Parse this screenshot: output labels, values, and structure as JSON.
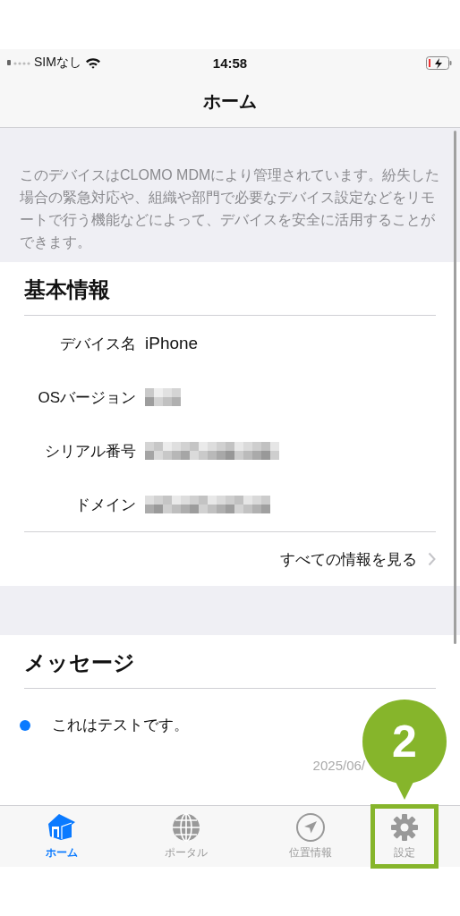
{
  "status_bar": {
    "carrier": "SIMなし",
    "time": "14:58",
    "battery_charging": true
  },
  "nav_bar": {
    "title": "ホーム"
  },
  "description": "このデバイスはCLOMO MDMにより管理されています。紛失した場合の緊急対応や、組織や部門で必要なデバイス設定などをリモートで行う機能などによって、デバイスを安全に活用することができます。",
  "basic_info": {
    "title": "基本情報",
    "rows": [
      {
        "label": "デバイス名",
        "kind": "text",
        "value": "iPhone"
      },
      {
        "label": "OSバージョン",
        "kind": "redacted"
      },
      {
        "label": "シリアル番号",
        "kind": "redacted"
      },
      {
        "label": "ドメイン",
        "kind": "redacted"
      }
    ],
    "more_link": "すべての情報を見る"
  },
  "messages": {
    "title": "メッセージ",
    "items": [
      {
        "text": "これはテストです。",
        "unread": true,
        "date": "2025/06/"
      }
    ]
  },
  "tab_bar": [
    {
      "label": "ホーム",
      "kind": "home",
      "selected": true,
      "highlighted": false
    },
    {
      "label": "ポータル",
      "kind": "portal",
      "selected": false,
      "highlighted": false
    },
    {
      "label": "位置情報",
      "kind": "location",
      "selected": false,
      "highlighted": false
    },
    {
      "label": "設定",
      "kind": "settings",
      "selected": false,
      "highlighted": true
    }
  ],
  "callout": {
    "label": "2"
  }
}
